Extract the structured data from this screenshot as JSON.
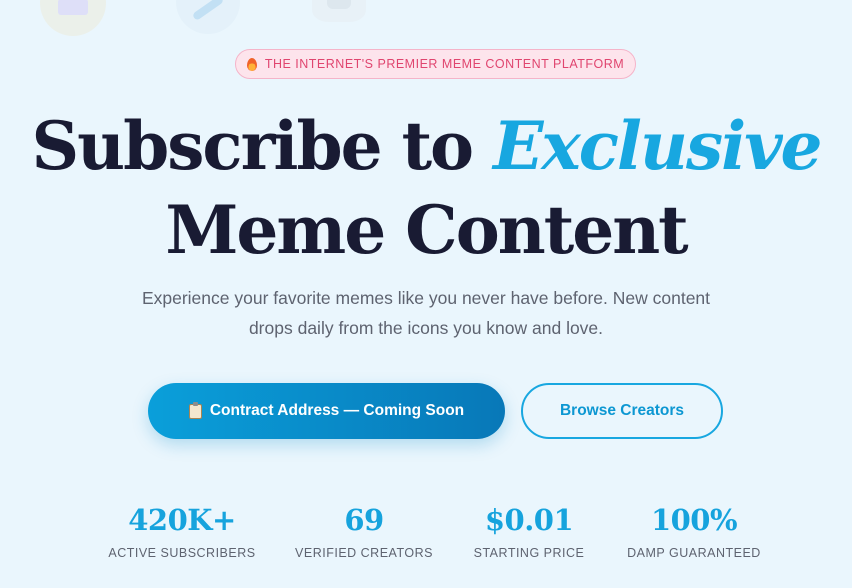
{
  "badge": {
    "icon": "fire-icon",
    "text": "THE INTERNET'S PREMIER MEME CONTENT PLATFORM"
  },
  "headline": {
    "line1_part1": "Subscribe to ",
    "line1_accent": "Exclusive",
    "line2": "Meme Content"
  },
  "subtitle": "Experience your favorite memes like you never have before. New content drops daily from the icons you know and love.",
  "buttons": {
    "primary_icon": "clipboard-icon",
    "primary_label": "Contract Address — Coming Soon",
    "secondary_label": "Browse Creators"
  },
  "stats": [
    {
      "value": "420K+",
      "label": "ACTIVE SUBSCRIBERS"
    },
    {
      "value": "69",
      "label": "VERIFIED CREATORS"
    },
    {
      "value": "$0.01",
      "label": "STARTING PRICE"
    },
    {
      "value": "100%",
      "label": "DAMP GUARANTEED"
    }
  ],
  "colors": {
    "accent": "#18a7e0",
    "headline": "#191b33",
    "badge_text": "#e0456f",
    "background": "#eaf6fd"
  }
}
